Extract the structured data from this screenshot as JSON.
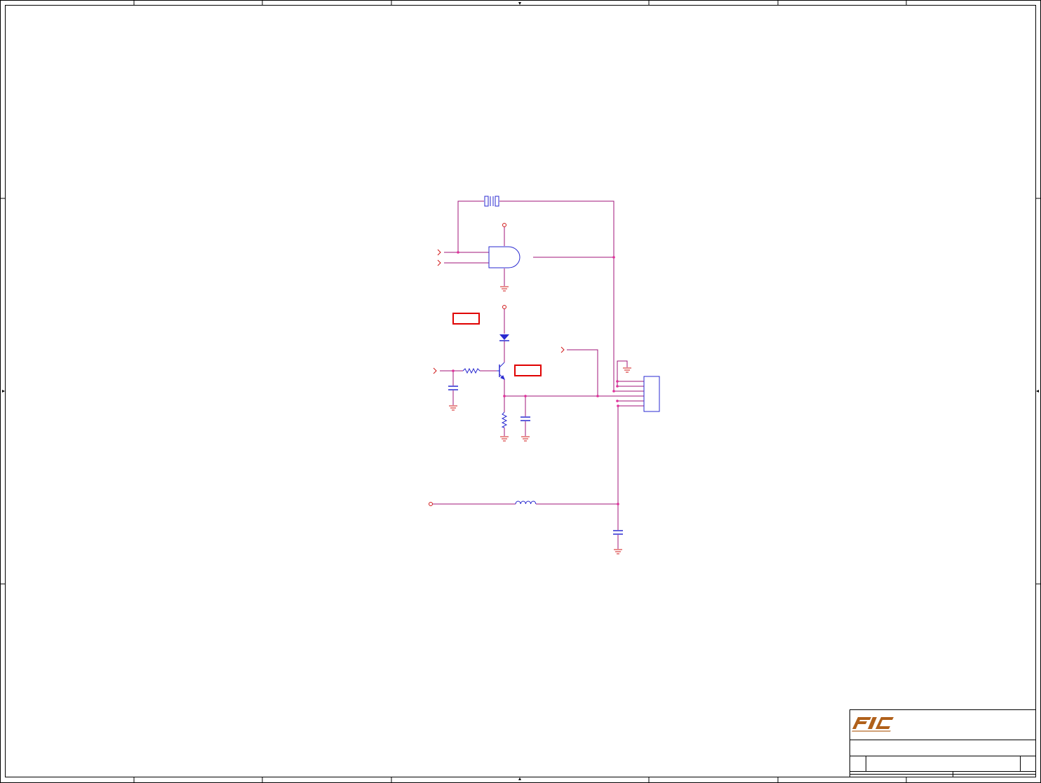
{
  "sheet": {
    "zone_columns": 8,
    "zone_rows": 4
  },
  "colors": {
    "frame": "#000000",
    "wire": "#a0147a",
    "component": "#2a2ad0",
    "power_ground": "#d01818",
    "junction": "#e0309a",
    "no_stuff_box": "#e00000",
    "logo_primary": "#b0601a"
  },
  "schematic": {
    "components": [
      {
        "ref": "crystal",
        "icon": "crystal-icon"
      },
      {
        "ref": "and-gate",
        "icon": "and-gate-icon"
      },
      {
        "ref": "diode",
        "icon": "diode-icon"
      },
      {
        "ref": "npn-transistor",
        "icon": "npn-transistor-icon"
      },
      {
        "ref": "base-resistor",
        "icon": "resistor-icon"
      },
      {
        "ref": "emitter-resistor",
        "icon": "resistor-icon"
      },
      {
        "ref": "input-capacitor",
        "icon": "capacitor-icon"
      },
      {
        "ref": "output-capacitor",
        "icon": "capacitor-icon"
      },
      {
        "ref": "filter-capacitor",
        "icon": "capacitor-icon"
      },
      {
        "ref": "inductor",
        "icon": "inductor-icon"
      },
      {
        "ref": "connector",
        "icon": "connector-icon"
      }
    ],
    "off_page_connectors": 4,
    "ground_symbols": 6,
    "power_ports": 3,
    "placeholder_boxes": 2
  },
  "title_block": {
    "logo": "FIC",
    "title": "",
    "size": "",
    "document_number": "",
    "rev": "",
    "date": "",
    "sheet": ""
  }
}
